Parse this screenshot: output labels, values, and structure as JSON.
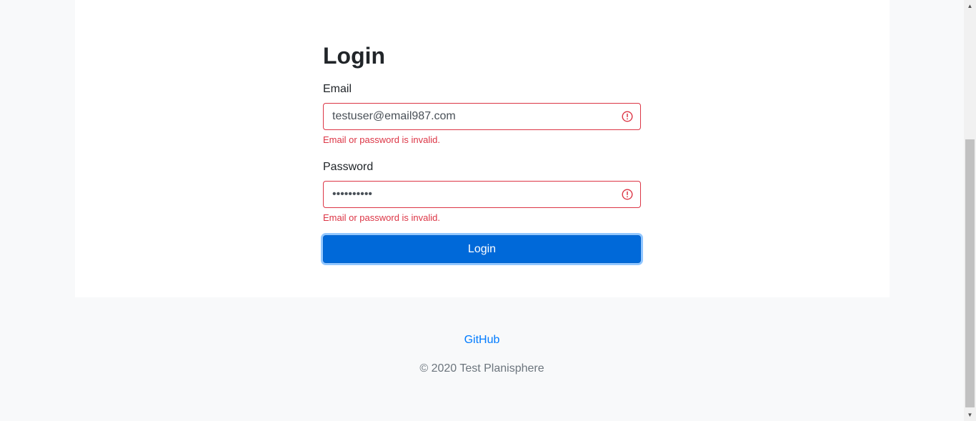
{
  "login": {
    "title": "Login",
    "email_label": "Email",
    "email_value": "testuser@email987.com",
    "email_error": "Email or password is invalid.",
    "password_label": "Password",
    "password_value": "••••••••••",
    "password_error": "Email or password is invalid.",
    "submit_label": "Login"
  },
  "footer": {
    "link_label": "GitHub",
    "copyright": "© 2020 Test Planisphere"
  },
  "colors": {
    "error": "#dc3545",
    "primary": "#0069d9",
    "link": "#007bff"
  },
  "icons": {
    "field_warning": "exclamation-circle-icon"
  }
}
